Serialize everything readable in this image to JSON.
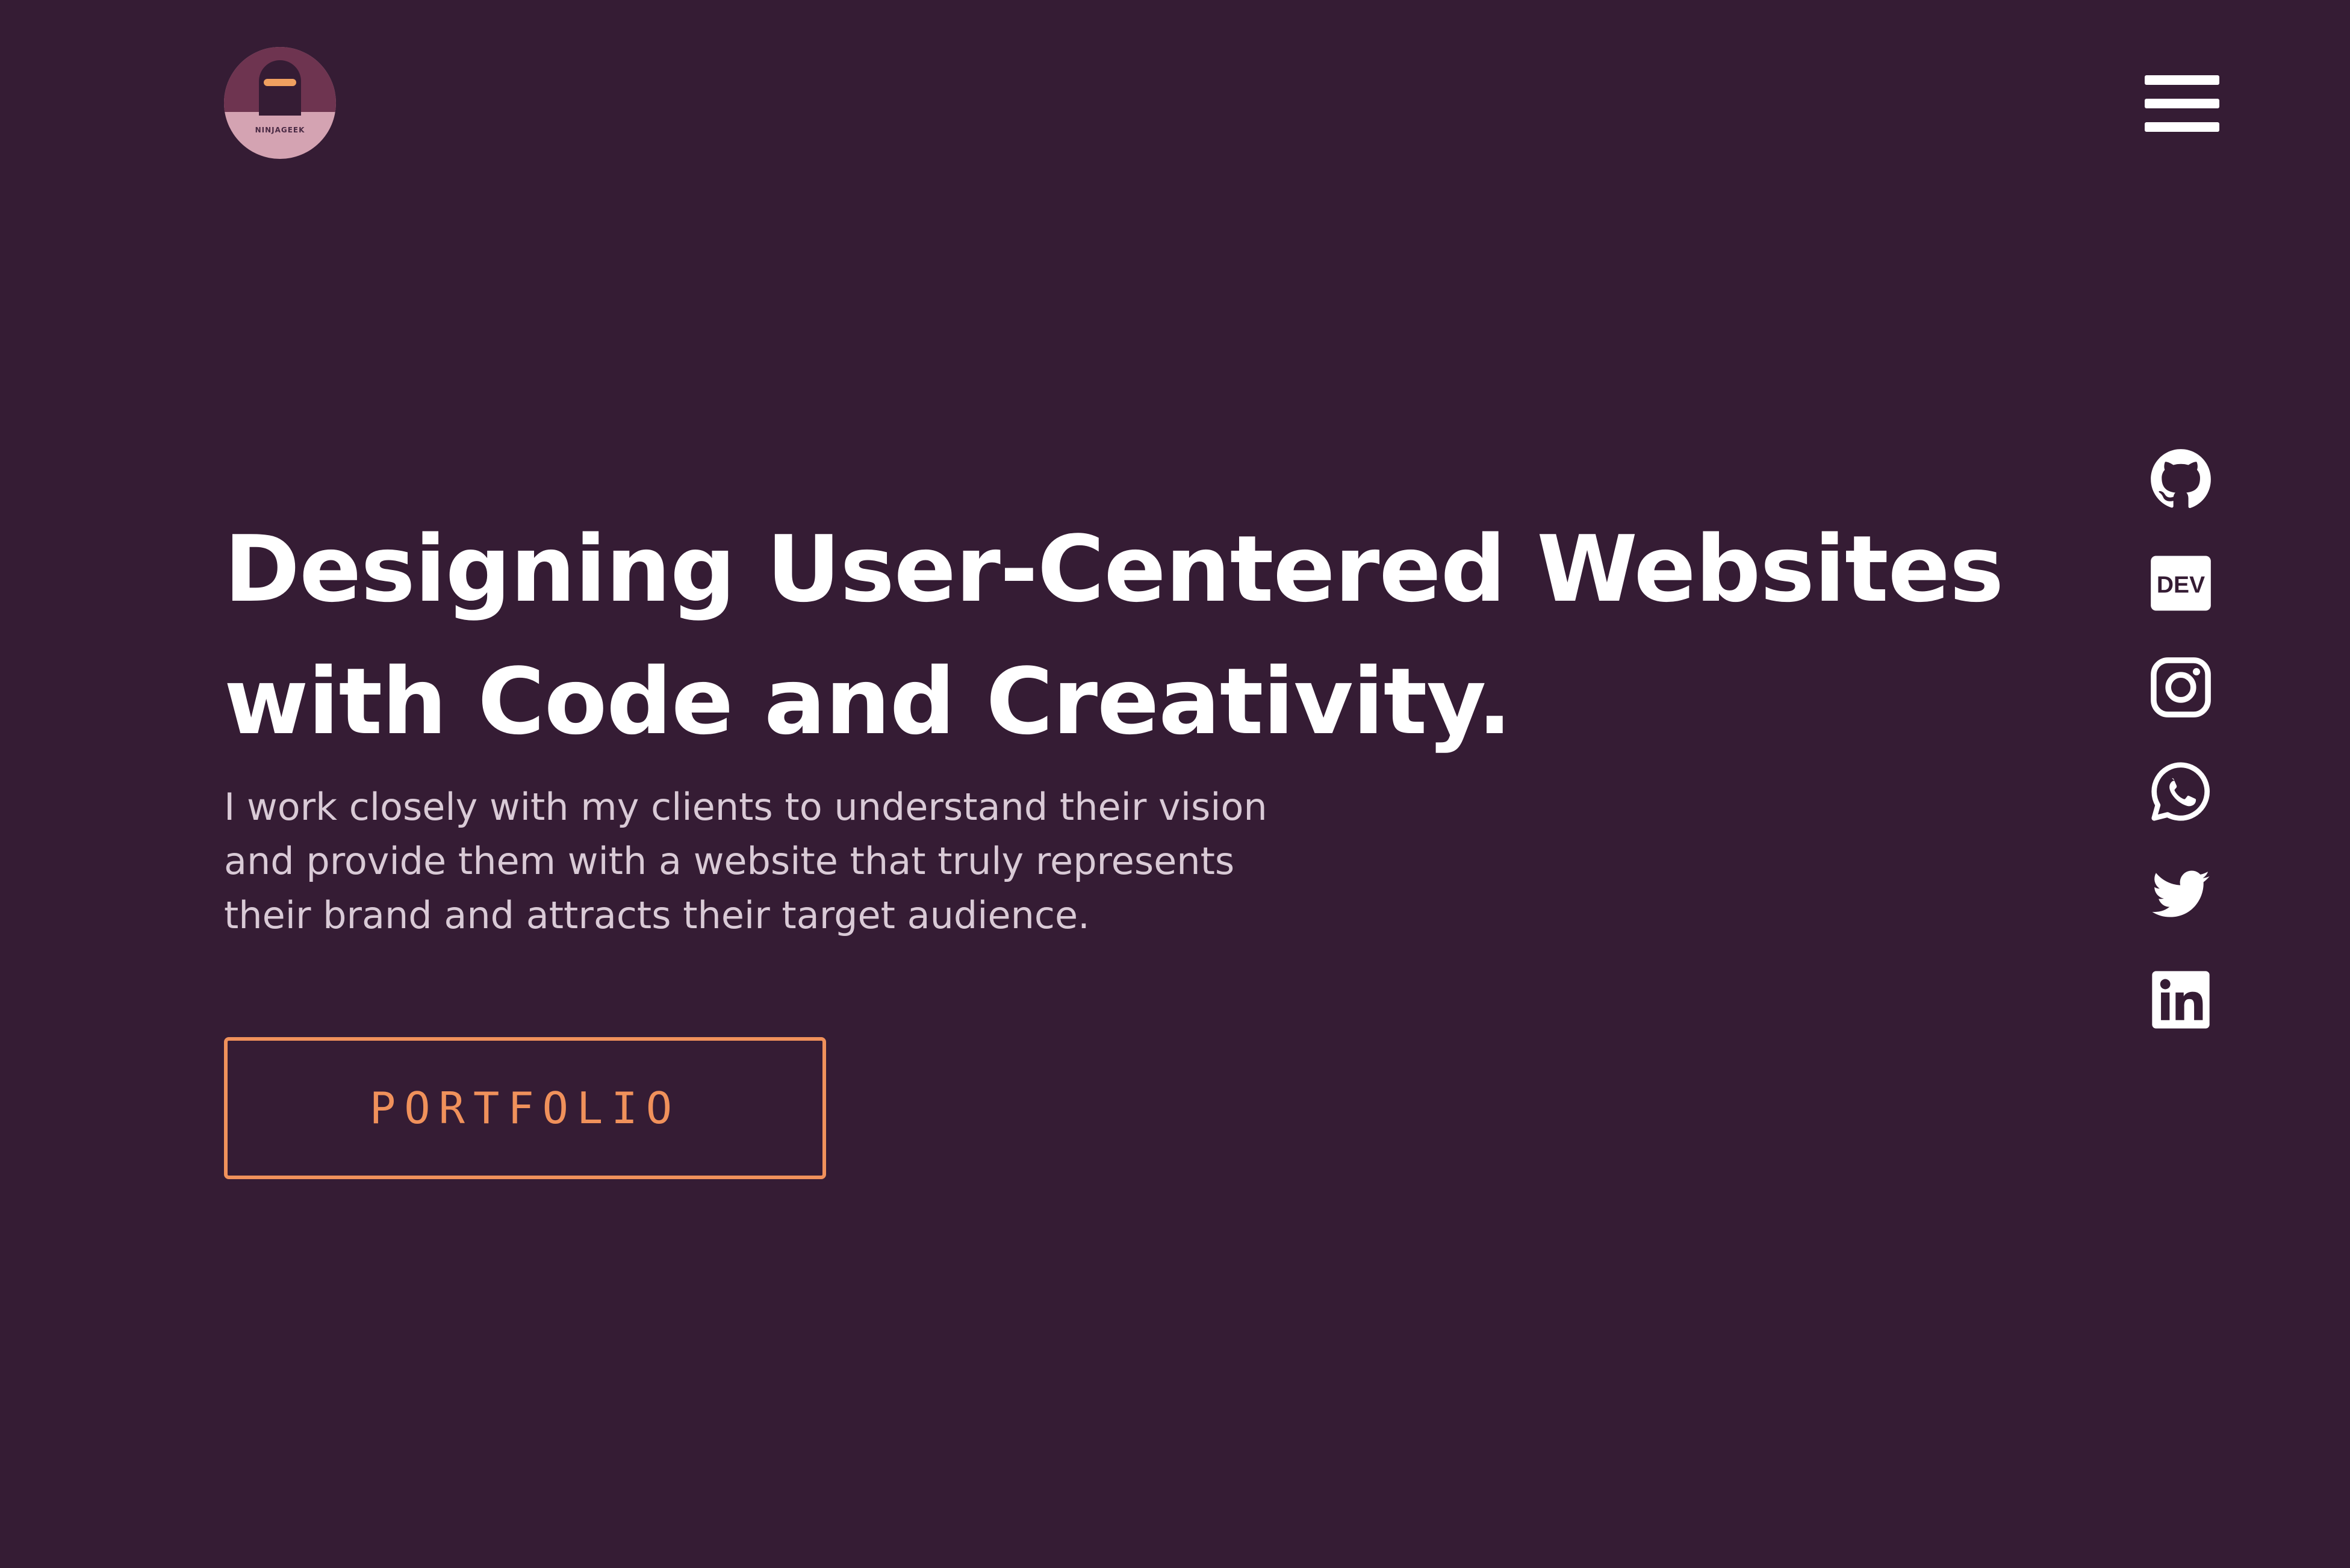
{
  "header": {
    "logo_text": "NINJAGEEK",
    "menu_icon": "hamburger-menu-icon"
  },
  "hero": {
    "title_line1": "Designing User-Centered Websites",
    "title_line2": "with Code and Creativity.",
    "subtitle": "I work closely with my clients to understand their vision and provide them with a website that truly represents their brand and attracts their target audience.",
    "cta_label": "PORTFOLIO"
  },
  "socials": [
    {
      "icon": "github-icon"
    },
    {
      "icon": "dev-icon",
      "label": "DEV"
    },
    {
      "icon": "instagram-icon"
    },
    {
      "icon": "whatsapp-icon"
    },
    {
      "icon": "twitter-icon"
    },
    {
      "icon": "linkedin-icon"
    }
  ],
  "colors": {
    "background": "#351c34",
    "accent": "#f0915b",
    "text": "#ffffff",
    "muted_text": "#d9cad6"
  }
}
